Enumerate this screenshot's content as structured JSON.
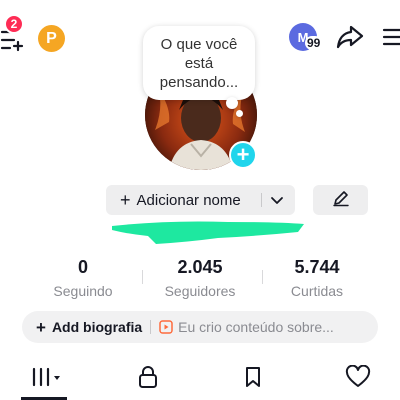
{
  "header": {
    "notification_count": "2",
    "coin_letter": "P",
    "account_initial": "M",
    "account_count": "99"
  },
  "thought_bubble": {
    "text": "O que você está pensando..."
  },
  "profile": {
    "add_name_label": "Adicionar nome"
  },
  "stats": [
    {
      "value": "0",
      "label": "Seguindo"
    },
    {
      "value": "2.045",
      "label": "Seguidores"
    },
    {
      "value": "5.744",
      "label": "Curtidas"
    }
  ],
  "bio": {
    "add_label": "Add biografia",
    "hint": "Eu crio conteúdo sobre..."
  },
  "tabs": [
    "videos-grid-icon",
    "lock-icon",
    "bookmark-icon",
    "heart-icon"
  ],
  "colors": {
    "badge": "#fe2c55",
    "coin": "#f5a623",
    "accent_plus": "#20d5ec",
    "highlight_mark": "#1ee8a0",
    "account_avatar": "#5b6ae0"
  }
}
